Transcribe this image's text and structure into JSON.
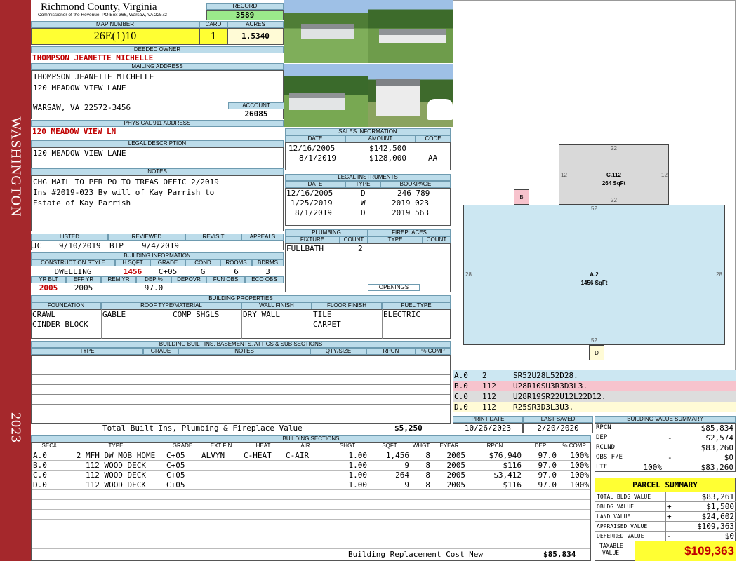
{
  "sidebar": {
    "top_text": "WASHINGTON",
    "bottom_text": "2023"
  },
  "header": {
    "county": "Richmond County, Virginia",
    "office": "Commissioner of the Revenue, PO Box 366, Warsaw, VA 22572",
    "record_label": "RECORD",
    "record": "3589",
    "map_label": "MAP NUMBER",
    "map": "26E(1)10",
    "card_label": "CARD",
    "card": "1",
    "acres_label": "ACRES",
    "acres": "1.5340"
  },
  "owner": {
    "label": "DEEDED OWNER",
    "name": "THOMPSON JEANETTE MICHELLE",
    "mailing_label": "MAILING ADDRESS",
    "mail1": "THOMPSON JEANETTE MICHELLE",
    "mail2": "120 MEADOW VIEW LANE",
    "mail3": "WARSAW, VA 22572-3456",
    "account_label": "ACCOUNT",
    "account": "26085"
  },
  "physical": {
    "label": "PHYSICAL 911 ADDRESS",
    "value": "120 MEADOW VIEW LN"
  },
  "legal": {
    "label": "LEGAL DESCRIPTION",
    "value": "120 MEADOW VIEW LANE"
  },
  "notes": {
    "label": "NOTES",
    "line1": "CHG MAIL TO PER PO TO TREAS OFFIC 2/2019",
    "line2": "Ins #2019-023 By will of Kay Parrish to",
    "line3": "Estate of Kay Parrish"
  },
  "listing": {
    "listed_label": "LISTED",
    "reviewed_label": "REVIEWED",
    "revisit_label": "REVISIT",
    "appeals_label": "APPEALS",
    "listed_by": "JC",
    "listed_date": "9/10/2019",
    "reviewed_by": "BTP",
    "reviewed_date": "9/4/2019"
  },
  "building_info": {
    "label": "BUILDING INFORMATION",
    "h1": "CONSTRUCTION STYLE",
    "h2": "H SQFT",
    "h3": "GRADE",
    "h4": "COND",
    "h5": "ROOMS",
    "h6": "BDRMS",
    "style": "DWELLING",
    "hsqft": "1456",
    "grade": "C+05",
    "cond": "G",
    "rooms": "6",
    "bdrms": "3",
    "g1": "YR BLT",
    "g2": "EFF YR",
    "g3": "REM YR",
    "g4": "DEP %",
    "g5": "DEPOVR",
    "g6": "FUN OBS",
    "g7": "ECO OBS",
    "yrblt": "2005",
    "effyr": "2005",
    "dep": "97.0"
  },
  "props": {
    "label": "BUILDING PROPERTIES",
    "h1": "FOUNDATION",
    "h2": "ROOF TYPE/MATERIAL",
    "h3": "WALL FINISH",
    "h4": "FLOOR FINISH",
    "h5": "FUEL TYPE",
    "f1": "CRAWL",
    "f2": "CINDER BLOCK",
    "roof1": "GABLE",
    "roof2": "COMP SHGLS",
    "wall": "DRY WALL",
    "floor1": "TILE",
    "floor2": "CARPET",
    "fuel": "ELECTRIC"
  },
  "builtins": {
    "label": "BUILDING BUILT INS, BASEMENTS, ATTICS & SUB SECTIONS",
    "h1": "TYPE",
    "h2": "GRADE",
    "h3": "NOTES",
    "h4": "QTY/SIZE",
    "h5": "RPCN",
    "h6": "% COMP",
    "total_label": "Total Built Ins, Plumbing & Fireplace Value",
    "total": "$5,250"
  },
  "sales": {
    "label": "SALES INFORMATION",
    "h1": "DATE",
    "h2": "AMOUNT",
    "h3": "CODE",
    "rows": [
      {
        "date": "12/16/2005",
        "amount": "$142,500",
        "code": ""
      },
      {
        "date": "8/1/2019",
        "amount": "$128,000",
        "code": "AA"
      }
    ]
  },
  "instruments": {
    "label": "LEGAL INSTRUMENTS",
    "h1": "DATE",
    "h2": "TYPE",
    "h3": "BOOKPAGE",
    "rows": [
      {
        "date": "12/16/2005",
        "type": "D",
        "book": "246 789"
      },
      {
        "date": "1/25/2019",
        "type": "W",
        "book": "2019 023"
      },
      {
        "date": "8/1/2019",
        "type": "D",
        "book": "2019 563"
      }
    ]
  },
  "plumbing": {
    "label": "PLUMBING",
    "h1": "FIXTURE",
    "h2": "COUNT",
    "fixture": "FULLBATH",
    "count": "2"
  },
  "fireplaces": {
    "label": "FIREPLACES",
    "h1": "TYPE",
    "h2": "COUNT",
    "openings": "OPENINGS"
  },
  "sketch": {
    "c_label": "C.112",
    "c_area": "264 SqFt",
    "a_label": "A.2",
    "a_area": "1456 SqFt",
    "b": "B",
    "d": "D",
    "n22a": "22",
    "n22b": "22",
    "n12a": "12",
    "n12b": "12",
    "n52a": "52",
    "n52b": "52",
    "n28a": "28",
    "n28b": "28"
  },
  "traverse": [
    {
      "sec": "A.0",
      "code": "2",
      "path": "SR52U28L52D28.",
      "color": "#cce7f2"
    },
    {
      "sec": "B.0",
      "code": "112",
      "path": "U28R10SU3R3D3L3.",
      "color": "#f7c3cd"
    },
    {
      "sec": "C.0",
      "code": "112",
      "path": "U28R19SR22U12L22D12.",
      "color": "#dddddd"
    },
    {
      "sec": "D.0",
      "code": "112",
      "path": "R25SR3D3L3U3.",
      "color": "#fffbd6"
    }
  ],
  "dates": {
    "print_label": "PRINT DATE",
    "saved_label": "LAST SAVED",
    "print": "10/26/2023",
    "saved": "2/20/2020"
  },
  "bvs": {
    "label": "BUILDING VALUE SUMMARY",
    "rows": [
      {
        "k": "RPCN",
        "s": "",
        "v": "$85,834"
      },
      {
        "k": "DEP",
        "s": "-",
        "v": "$2,574"
      },
      {
        "k": "RCLND",
        "s": "",
        "v": "$83,260"
      },
      {
        "k": "OBS F/E",
        "s": "-",
        "v": "$0"
      },
      {
        "k": "LTF",
        "s": "100%",
        "v": "$83,260"
      }
    ]
  },
  "sections": {
    "label": "BUILDING SECTIONS",
    "h": [
      "SEC#",
      "TYPE",
      "GRADE",
      "EXT FIN",
      "HEAT",
      "AIR",
      "SHGT",
      "SQFT",
      "WHGT",
      "EYEAR",
      "RPCN",
      "DEP",
      "% COMP"
    ],
    "rows": [
      [
        "A.0",
        "2 MFH DW MOB HOME",
        "C+05",
        "ALVYN",
        "C-HEAT",
        "C-AIR",
        "1.00",
        "1,456",
        "8",
        "2005",
        "$76,940",
        "97.0",
        "100%"
      ],
      [
        "B.0",
        "112 WOOD DECK",
        "C+05",
        "",
        "",
        "",
        "1.00",
        "9",
        "8",
        "2005",
        "$116",
        "97.0",
        "100%"
      ],
      [
        "C.0",
        "112 WOOD DECK",
        "C+05",
        "",
        "",
        "",
        "1.00",
        "264",
        "8",
        "2005",
        "$3,412",
        "97.0",
        "100%"
      ],
      [
        "D.0",
        "112 WOOD DECK",
        "C+05",
        "",
        "",
        "",
        "1.00",
        "9",
        "8",
        "2005",
        "$116",
        "97.0",
        "100%"
      ]
    ],
    "repl_label": "Building Replacement Cost New",
    "repl": "$85,834"
  },
  "parcel": {
    "label": "PARCEL SUMMARY",
    "rows": [
      {
        "k": "TOTAL BLDG VALUE",
        "s": "",
        "v": "$83,261"
      },
      {
        "k": "OBLDG VALUE",
        "s": "+",
        "v": "$1,500"
      },
      {
        "k": "LAND VALUE",
        "s": "+",
        "v": "$24,602"
      },
      {
        "k": "APPRAISED VALUE",
        "s": "",
        "v": "$109,363"
      },
      {
        "k": "DEFERRED VALUE",
        "s": "-",
        "v": "$0"
      }
    ],
    "taxable_label1": "TAXABLE",
    "taxable_label2": "VALUE",
    "taxable": "$109,363"
  },
  "colors": {
    "header_bg": "#bcdcea",
    "sidebar": "#a5282c",
    "yellow": "#ffff33",
    "green": "#9be98b",
    "red_text": "#c00000"
  }
}
